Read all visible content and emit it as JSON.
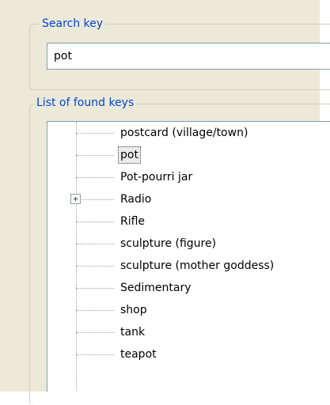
{
  "search_group": {
    "legend": "Search key",
    "value": "pot"
  },
  "list_group": {
    "legend": "List of found keys"
  },
  "tree_items": [
    {
      "label": "postcard (village/town)"
    },
    {
      "label": "pot",
      "selected": true
    },
    {
      "label": "Pot-pourri jar"
    },
    {
      "label": "Radio",
      "expandable": true,
      "expander_symbol": "+"
    },
    {
      "label": "Rifle"
    },
    {
      "label": "sculpture (figure)"
    },
    {
      "label": "sculpture (mother goddess)"
    },
    {
      "label": "Sedimentary"
    },
    {
      "label": "shop"
    },
    {
      "label": "tank"
    },
    {
      "label": "teapot"
    }
  ],
  "colors": {
    "legend_text": "#0046d5",
    "panel_bg": "#ece9d8",
    "input_border": "#7f9db9"
  }
}
